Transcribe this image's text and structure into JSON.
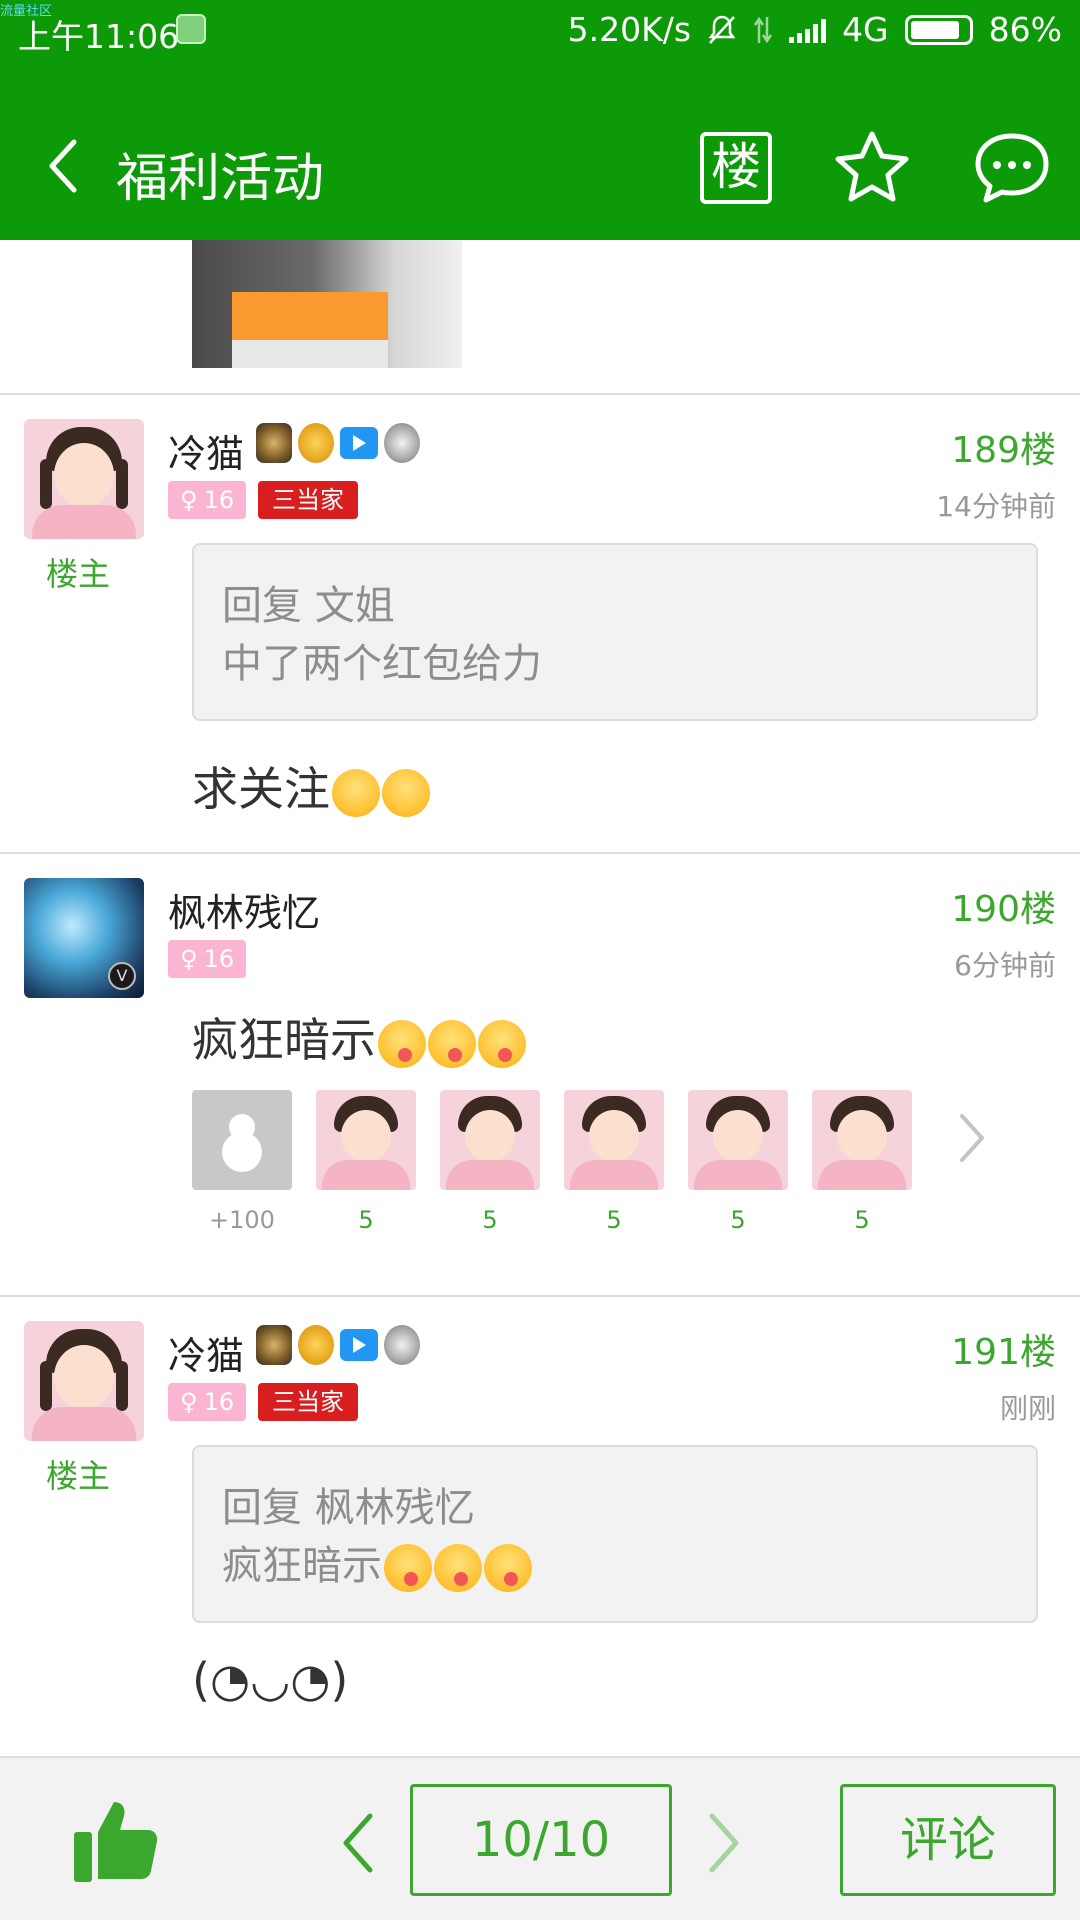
{
  "status_bar": {
    "top_left_tiny": "流量社区",
    "time": "上午11:06",
    "speed": "5.20K/s",
    "network": "4G",
    "battery": "86%",
    "battery_level": 0.86
  },
  "header": {
    "title": "福利活动",
    "floor_button_label": "楼"
  },
  "posts": [
    {
      "username": "冷猫",
      "is_op": true,
      "op_label": "楼主",
      "level": "16",
      "title_badge": "三当家",
      "floor": "189楼",
      "time": "14分钟前",
      "quote": {
        "line1": "回复 文姐",
        "line2": "中了两个红包给力"
      },
      "text": "求关注",
      "text_emojis": [
        "smile-emoji",
        "smile-emoji"
      ]
    },
    {
      "username": "枫林残忆",
      "is_op": false,
      "level": "16",
      "floor": "190楼",
      "time": "6分钟前",
      "text": "疯狂暗示",
      "text_emojis": [
        "tongue-emoji",
        "tongue-emoji",
        "tongue-emoji"
      ],
      "rewards": [
        {
          "icon": "gourd-icon",
          "count": "+100"
        },
        {
          "icon": "avatar",
          "count": "5"
        },
        {
          "icon": "avatar",
          "count": "5"
        },
        {
          "icon": "avatar",
          "count": "5"
        },
        {
          "icon": "avatar",
          "count": "5"
        },
        {
          "icon": "avatar",
          "count": "5"
        }
      ]
    },
    {
      "username": "冷猫",
      "is_op": true,
      "op_label": "楼主",
      "level": "16",
      "title_badge": "三当家",
      "floor": "191楼",
      "time": "刚刚",
      "quote": {
        "line1": "回复 枫林残忆",
        "line2": "疯狂暗示"
      },
      "text": "(◔◡◔)"
    }
  ],
  "bottom_bar": {
    "page_indicator": "10/10",
    "comment_label": "评论"
  },
  "colors": {
    "brand_green": "#0d9a08",
    "accent_green": "#3ca72f",
    "title_badge_red": "#d81e1e",
    "level_badge_pink": "#fbb5d2"
  }
}
